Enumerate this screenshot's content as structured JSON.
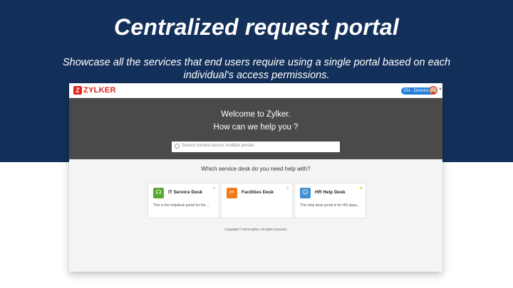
{
  "slide": {
    "title": "Centralized request portal",
    "subtitle": "Showcase all the services that end users require using a single portal based on each individual's access permissions."
  },
  "portal": {
    "logo_text": "ZYLKER",
    "logo_mark": "Z",
    "language_button": "EN - Directory",
    "welcome_line1": "Welcome to Zylker.",
    "welcome_line2": "How can we help you ?",
    "search_placeholder": "Search content across multiple portals",
    "question": "Which service desk do you need help with?",
    "cards": [
      {
        "title": "IT Service Desk",
        "description": "This is the helpdesk portal for the ...",
        "icon": "headset-icon",
        "icon_glyph": "☊",
        "icon_color": "#5aa832",
        "favorited": false
      },
      {
        "title": "Facilities Desk",
        "description": "",
        "icon": "tools-icon",
        "icon_glyph": "✂",
        "icon_color": "#f07b1d",
        "favorited": false
      },
      {
        "title": "HR Help Desk",
        "description": "This help desk portal is for HR depa...",
        "icon": "person-card-icon",
        "icon_glyph": "☺",
        "icon_color": "#3e8ed0",
        "favorited": true
      }
    ],
    "copyright": "Copyright © 2019 Zylker. All rights reserved."
  },
  "colors": {
    "hero": "#13305a",
    "accent_red": "#e2231a",
    "star_favorite": "#f2c200",
    "star_default": "#cfcfcf"
  }
}
